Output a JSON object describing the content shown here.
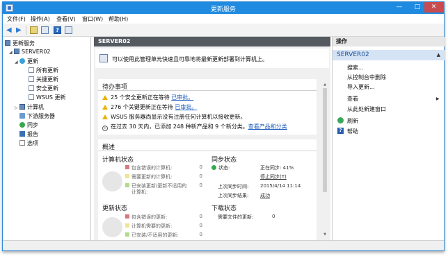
{
  "window": {
    "title": "更新服务",
    "minimize": "—",
    "maximize": "□",
    "close": "✕"
  },
  "menu": [
    "文件(F)",
    "操作(A)",
    "查看(V)",
    "窗口(W)",
    "帮助(H)"
  ],
  "toolbar": {
    "back": "◀",
    "forward": "▶",
    "help_glyph": "?"
  },
  "tree": {
    "root": "更新服务",
    "server": "SERVER02",
    "updates": "更新",
    "all_updates": "所有更新",
    "critical_updates": "关键更新",
    "security_updates": "安全更新",
    "wsus_updates": "WSUS 更新",
    "computers": "计算机",
    "downstream": "下游服务器",
    "sync": "同步",
    "reports": "报告",
    "options": "选项"
  },
  "center": {
    "header": "SERVER02",
    "banner": "可以使用此管理单元快速且可靠地将最新更新部署到计算机上。",
    "todo_title": "待办事项",
    "todo": [
      {
        "text": "25 个安全更新正在等待 ",
        "link": "已审批。"
      },
      {
        "text": "276 个关键更新正在等待 ",
        "link": "已审批。"
      },
      {
        "text": "WSUS 服务器尚显示没有注册任何计算机以接收更新。",
        "link": ""
      },
      {
        "text": "在过去 30 天内，已添加 248 种新产品和 9 个新分类。",
        "link": "查看产品和分类"
      }
    ],
    "overview_title": "概述",
    "computer_status": {
      "title": "计算机状态",
      "legend": [
        {
          "label": "包含错误的计算机:",
          "count": "0",
          "color": "red"
        },
        {
          "label": "需要更新的计算机:",
          "count": "0",
          "color": "yellow"
        },
        {
          "label": "已安装更新/更新不适用的",
          "label2": "计算机:",
          "count": "0",
          "color": "green"
        }
      ]
    },
    "sync_status": {
      "title": "同步状态",
      "status_label": "状态:",
      "status_value": "正在同步: 41%",
      "stop_link": "停止同步(T)",
      "last_sync_label": "上次同步时间:",
      "last_sync_value": "2015/4/14 11:14",
      "last_result_label": "上次同步结果:",
      "last_result_value": "成功"
    },
    "update_status": {
      "title": "更新状态",
      "legend": [
        {
          "label": "包含错误的更新:",
          "count": "0",
          "color": "red"
        },
        {
          "label": "计算机需要的更新:",
          "count": "0",
          "color": "yellow"
        },
        {
          "label": "已安装/不适用的更新:",
          "count": "0",
          "color": "green"
        }
      ]
    },
    "download_status": {
      "title": "下载状态",
      "needed_label": "需要文件的更新:",
      "needed_value": "0"
    }
  },
  "actions": {
    "header": "操作",
    "subheader": "SERVER02",
    "caret": "▲",
    "items": [
      "搜索...",
      "从控制台中删除",
      "导入更新...",
      "查看",
      "从此处新建窗口",
      "刷新",
      "帮助"
    ],
    "submenu_arrow": "▶"
  },
  "colors": {
    "titlebar": "#1e8ae0",
    "close": "#c74b50",
    "header": "#555a60",
    "link": "#1f5fbf"
  }
}
